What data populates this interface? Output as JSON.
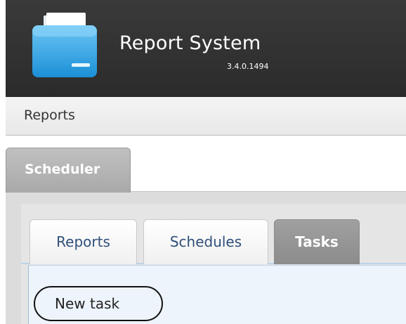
{
  "header": {
    "app_title": "Report System",
    "version": "3.4.0.1494",
    "logo_icon": "folder-icon"
  },
  "menubar": {
    "items": [
      {
        "label": "Reports"
      }
    ]
  },
  "main_tabs": [
    {
      "label": "Scheduler",
      "active": true
    }
  ],
  "sub_tabs": [
    {
      "label": "Reports",
      "active": false
    },
    {
      "label": "Schedules",
      "active": false
    },
    {
      "label": "Tasks",
      "active": true
    }
  ],
  "toolbar": {
    "new_task_label": "New task"
  },
  "colors": {
    "header_bg": "#2f2f2f",
    "tab_label": "#2f4f7a",
    "active_tab": "#959595",
    "task_area_bg": "#eef4fb"
  }
}
